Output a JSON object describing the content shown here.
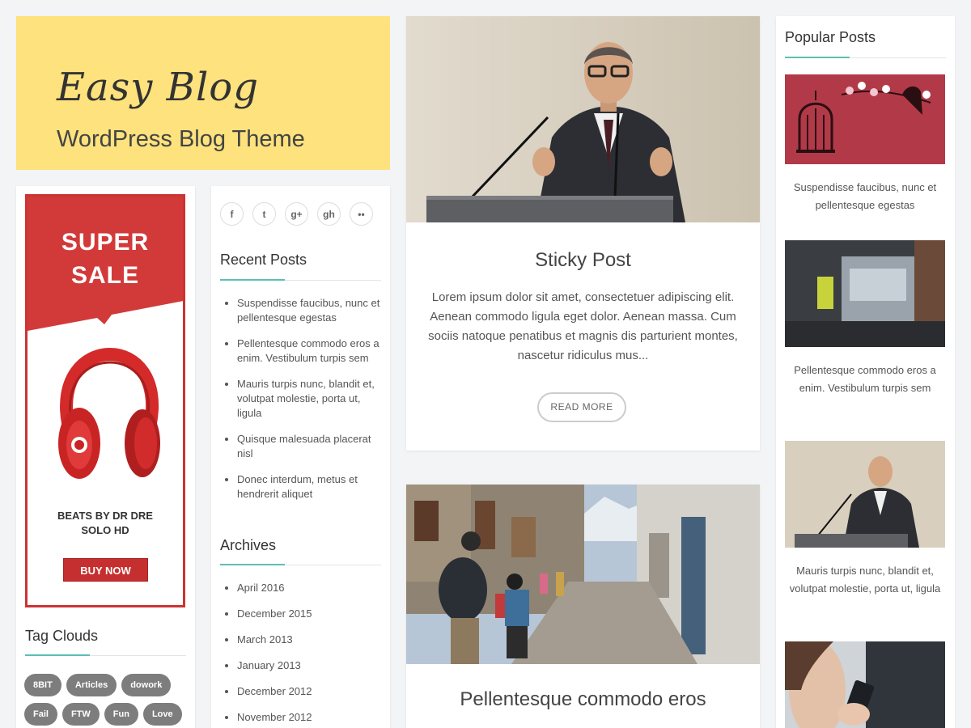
{
  "header": {
    "site_title": "Easy Blog",
    "tagline": "WordPress Blog Theme"
  },
  "ad": {
    "headline_line1": "SUPER",
    "headline_line2": "SALE",
    "product_line1": "BEATS BY DR DRE",
    "product_line2": "SOLO HD",
    "button_label": "BUY NOW",
    "brand_color": "#d23a3a"
  },
  "tag_cloud": {
    "title": "Tag Clouds",
    "tags": [
      "8BIT",
      "Articles",
      "dowork",
      "Fail",
      "FTW",
      "Fun",
      "Love"
    ]
  },
  "social": {
    "icons": [
      {
        "name": "facebook-icon",
        "glyph": "f"
      },
      {
        "name": "twitter-icon",
        "glyph": "t"
      },
      {
        "name": "google-plus-icon",
        "glyph": "g+"
      },
      {
        "name": "github-icon",
        "glyph": "gh"
      },
      {
        "name": "flickr-icon",
        "glyph": "••"
      }
    ]
  },
  "recent_posts": {
    "title": "Recent Posts",
    "items": [
      "Suspendisse faucibus, nunc et pellentesque egestas",
      "Pellentesque commodo eros a enim. Vestibulum turpis sem",
      "Mauris turpis nunc, blandit et, volutpat molestie, porta ut, ligula",
      "Quisque malesuada placerat nisl",
      "Donec interdum, metus et hendrerit aliquet"
    ]
  },
  "archives": {
    "title": "Archives",
    "items": [
      "April 2016",
      "December 2015",
      "March 2013",
      "January 2013",
      "December 2012",
      "November 2012"
    ]
  },
  "posts": [
    {
      "title": "Sticky Post",
      "excerpt": "Lorem ipsum dolor sit amet, consectetuer adipiscing elit. Aenean commodo ligula eget dolor. Aenean massa. Cum sociis natoque penatibus et magnis dis parturient montes, nascetur ridiculus mus...",
      "read_more": "READ MORE"
    },
    {
      "title": "Pellentesque commodo eros"
    }
  ],
  "popular_posts": {
    "title": "Popular Posts",
    "items": [
      "Suspendisse faucibus, nunc et pellentesque egestas",
      "Pellentesque commodo eros a enim. Vestibulum turpis sem",
      "Mauris turpis nunc, blandit et, volutpat molestie, porta ut, ligula"
    ]
  },
  "colors": {
    "header_bg": "#fde27d",
    "accent": "#5bbfb5",
    "tag_bg": "#7d7d7d",
    "page_bg": "#f3f4f6"
  }
}
